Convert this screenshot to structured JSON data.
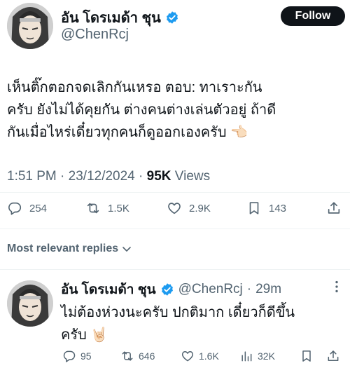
{
  "tweet": {
    "author_name": "อัน โดรเมด้า ชุน",
    "author_handle": "@ChenRcj",
    "follow_label": "Follow",
    "text_lines": [
      "เห็นติ๊กตอกจดเลิกกันเหรอ  ตอบ: ทาเราะกัน",
      "ครับ ยังไม่ได้คุยกัน ต่างคนต่างเล่นตัวอยู่ ถ้าดี",
      "กันเมื่อไหร่เดี๋ยวทุกคนก็ดูออกเองครับ 👈🏻"
    ],
    "time": "1:51 PM",
    "date": "23/12/2024",
    "separator": "·",
    "views_count": "95K",
    "views_label": "Views",
    "replies": "254",
    "retweets": "1.5K",
    "likes": "2.9K",
    "bookmarks": "143",
    "icons": [
      "reply-icon",
      "retweet-icon",
      "like-icon",
      "bookmark-icon",
      "share-icon",
      "verified-badge-icon",
      "chevron-down-icon",
      "more-icon",
      "views-chart-icon"
    ],
    "accent_color": "#1d9bf0"
  },
  "replies_header": {
    "label": "Most relevant replies"
  },
  "reply": {
    "author_name": "อัน โดรเมด้า ชุน",
    "author_handle": "@ChenRcj",
    "dot": "·",
    "time": "29m",
    "text_lines": [
      "ไม่ต้องห่วงนะครับ ปกติมาก เดี๋ยวก็ดีขึ้น",
      "ครับ 🤘🏻"
    ],
    "replies": "95",
    "retweets": "646",
    "likes": "1.6K",
    "views": "32K"
  }
}
